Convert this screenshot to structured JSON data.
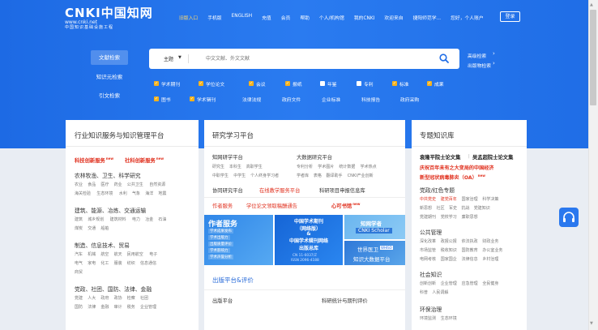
{
  "logo": {
    "line1": "CNKI中国知网",
    "line2": "www.cnki.net",
    "line3": "中国知识基础设施工程"
  },
  "topnav": [
    "旧版入口",
    "手机版",
    "ENGLISH",
    "充值",
    "会员",
    "帮助",
    "个人/机构馆",
    "我的CNKI",
    "欢迎来自",
    "捷阳师范学...",
    "您好，个人账户"
  ],
  "login": "登录",
  "tabs": [
    "文献检索",
    "知识元检索",
    "引文检索"
  ],
  "search": {
    "field": "主题",
    "placeholder": "中文文献、外文文献"
  },
  "right_links": [
    "高级检索",
    "出版物检索"
  ],
  "checks_row1": [
    {
      "label": "学术期刊",
      "on": true
    },
    {
      "label": "学位论文",
      "on": true
    },
    {
      "label": "会议",
      "on": true
    },
    {
      "label": "报纸",
      "on": true
    },
    {
      "label": "年鉴",
      "on": false
    },
    {
      "label": "专利",
      "on": false
    },
    {
      "label": "标准",
      "on": true
    },
    {
      "label": "成果",
      "on": true
    }
  ],
  "checks_row2": [
    {
      "label": "图书",
      "on": true
    },
    {
      "label": "学术辑刊",
      "on": true
    },
    {
      "label": "法律法规",
      "on": null
    },
    {
      "label": "政府文件",
      "on": null
    },
    {
      "label": "企业标准",
      "on": null
    },
    {
      "label": "科技报告",
      "on": null
    },
    {
      "label": "政府采购",
      "on": null
    }
  ],
  "p1": {
    "title": "行业知识服务与知识管理平台",
    "links": [
      "科技创新服务",
      "社科创新服务"
    ],
    "new": "new",
    "groups": [
      {
        "title": "农林牧渔、卫生、科学研究",
        "rows": [
          [
            "农业",
            "食品",
            "医疗",
            "药业",
            "公共卫生",
            "自然资源"
          ],
          [
            "海关检验",
            "生态环境",
            "水利",
            "气象",
            "海洋",
            "地震"
          ]
        ]
      },
      {
        "title": "建筑、能源、冶炼、交通运输",
        "rows": [
          [
            "建筑",
            "城乡规划",
            "建筑材料",
            "电力",
            "冶金",
            "石油"
          ],
          [
            "煤炭",
            "交通",
            "船舶"
          ]
        ]
      },
      {
        "title": "制造、信息技术、贸易",
        "rows": [
          [
            "汽车",
            "机械",
            "航空",
            "航天",
            "民用航空",
            "电子"
          ],
          [
            "电气",
            "家电",
            "化工",
            "服装",
            "纺织",
            "信息通信"
          ],
          [
            "商贸"
          ]
        ]
      },
      {
        "title": "党政、社团、国防、法律、金融",
        "rows": [
          [
            "党建",
            "人大",
            "政府",
            "政协",
            "检察",
            "社团"
          ],
          [
            "国防",
            "法律",
            "金融",
            "审计",
            "税务",
            "企业管理"
          ]
        ]
      }
    ]
  },
  "p2": {
    "title": "研究学习平台",
    "col1_title": "知网研学平台",
    "col1_rows": [
      [
        "研究生",
        "本科生",
        "高职学生"
      ],
      [
        "中职学生",
        "中学生",
        "个人终身学习者"
      ]
    ],
    "col2_title": "大数据研究平台",
    "col2_rows": [
      [
        "专利分析",
        "学术图片",
        "统计数据",
        "学术热点"
      ],
      [
        "学者库",
        "表格",
        "翻译助手",
        "CNKI产业创新"
      ]
    ],
    "row3": [
      "协同研究平台",
      "在线教学服务平台",
      "科研项目申报信息库"
    ],
    "row4": [
      "作者服务",
      "学位论文领取稿酬通告",
      "心可书馆"
    ],
    "banner1": {
      "title": "作者服务",
      "items": [
        "学术成果发布",
        "学术出版力",
        "出版质量评价",
        "学术影响力",
        "学术声誉分析"
      ]
    },
    "banner2": {
      "lines": [
        "中国学术期刊",
        "（网络版）",
        "&",
        "中国学术辑刊网络",
        "出版总库"
      ],
      "issn1": "CN 11-6037/Z",
      "issn2": "ISSN 2096-4188"
    },
    "banner3": {
      "line1": "知网学者",
      "line2": "CNKI Scholar"
    },
    "banner4": {
      "line1": "世界医卫",
      "tag": "WHISO",
      "line2": "知识大数据平台"
    },
    "pub_title": "出版平台&评价",
    "pub_col1": "出版平台",
    "pub_col2": "科研统计与期刊评价"
  },
  "p3": {
    "title": "专题知识库",
    "row1": [
      "袁隆平院士论文集",
      "吴孟超院士论文集"
    ],
    "row2": "庆祝百年未有之大变局的中国经济",
    "row3": "新型冠状病毒肺炎（OA）",
    "groups": [
      {
        "title": "党政/红色专题",
        "rows": [
          [
            "中共党史",
            "建党百年",
            "国家治理",
            "科学决策"
          ],
          [
            "新思想",
            "社区",
            "军史",
            "抗战",
            "党建知识"
          ],
          [
            "党建期刊",
            "党校学习",
            "廉职思想"
          ]
        ]
      },
      {
        "title": "公共管理",
        "rows": [
          [
            "深化改革",
            "政报公报",
            "依法执政",
            "财政业务"
          ],
          [
            "市场监管",
            "税收知识",
            "国防教育",
            "办公室业务"
          ],
          [
            "电网考核",
            "国家国企",
            "法律信息",
            "乡村治理"
          ]
        ]
      },
      {
        "title": "社会知识",
        "rows": [
          [
            "创新创新",
            "企业管理",
            "应急管理",
            "全民健身"
          ],
          [
            "科普",
            "人民调解"
          ]
        ]
      },
      {
        "title": "环保治理",
        "rows": [
          [
            "环境监测",
            "生态环境"
          ]
        ]
      }
    ]
  },
  "colors": {
    "hero": "#1f6de6",
    "accent": "#f6b21c",
    "red": "#e0301e",
    "float": "#2a78ee"
  }
}
